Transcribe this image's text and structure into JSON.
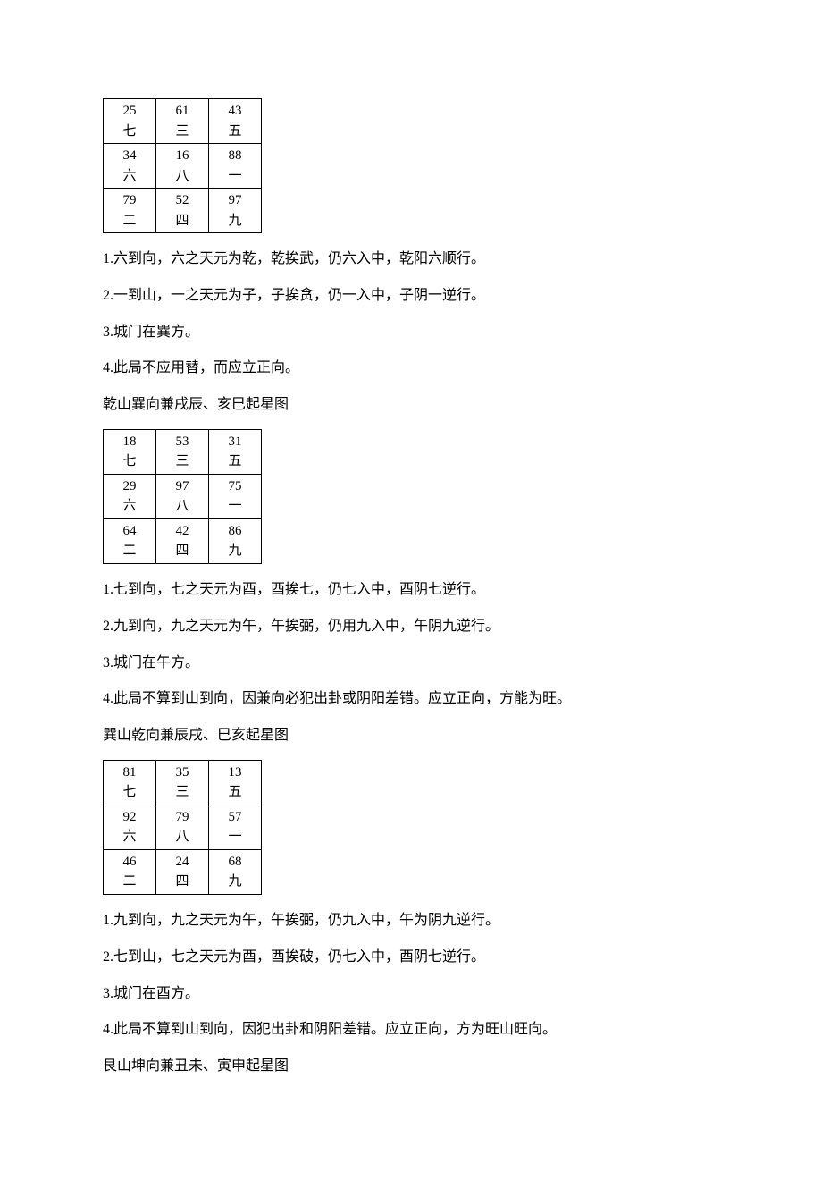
{
  "tables": [
    {
      "rows": [
        [
          {
            "top": "25",
            "bottom": "七"
          },
          {
            "top": "61",
            "bottom": "三"
          },
          {
            "top": "43",
            "bottom": "五"
          }
        ],
        [
          {
            "top": "34",
            "bottom": "六"
          },
          {
            "top": "16",
            "bottom": "八"
          },
          {
            "top": "88",
            "bottom": "一"
          }
        ],
        [
          {
            "top": "79",
            "bottom": "二"
          },
          {
            "top": "52",
            "bottom": "四"
          },
          {
            "top": "97",
            "bottom": "九"
          }
        ]
      ]
    },
    {
      "rows": [
        [
          {
            "top": "18",
            "bottom": "七"
          },
          {
            "top": "53",
            "bottom": "三"
          },
          {
            "top": "31",
            "bottom": "五"
          }
        ],
        [
          {
            "top": "29",
            "bottom": "六"
          },
          {
            "top": "97",
            "bottom": "八"
          },
          {
            "top": "75",
            "bottom": "一"
          }
        ],
        [
          {
            "top": "64",
            "bottom": "二"
          },
          {
            "top": "42",
            "bottom": "四"
          },
          {
            "top": "86",
            "bottom": "九"
          }
        ]
      ]
    },
    {
      "rows": [
        [
          {
            "top": "81",
            "bottom": "七"
          },
          {
            "top": "35",
            "bottom": "三"
          },
          {
            "top": "13",
            "bottom": "五"
          }
        ],
        [
          {
            "top": "92",
            "bottom": "六"
          },
          {
            "top": "79",
            "bottom": "八"
          },
          {
            "top": "57",
            "bottom": "一"
          }
        ],
        [
          {
            "top": "46",
            "bottom": "二"
          },
          {
            "top": "24",
            "bottom": "四"
          },
          {
            "top": "68",
            "bottom": "九"
          }
        ]
      ]
    }
  ],
  "sections": [
    {
      "notes": [
        "1.六到向，六之天元为乾，乾挨武，仍六入中，乾阳六顺行。",
        "2.一到山，一之天元为子，子挨贪，仍一入中，子阴一逆行。",
        "3.城门在巽方。",
        "4.此局不应用替，而应立正向。"
      ],
      "title": "乾山巽向兼戌辰、亥巳起星图"
    },
    {
      "notes": [
        "1.七到向，七之天元为酉，酉挨七，仍七入中，酉阴七逆行。",
        "2.九到向，九之天元为午，午挨弼，仍用九入中，午阴九逆行。",
        "3.城门在午方。",
        "4.此局不算到山到向，因兼向必犯出卦或阴阳差错。应立正向，方能为旺。"
      ],
      "title": "巽山乾向兼辰戌、巳亥起星图"
    },
    {
      "notes": [
        "1.九到向，九之天元为午，午挨弼，仍九入中，午为阴九逆行。",
        "2.七到山，七之天元为酉，酉挨破，仍七入中，酉阴七逆行。",
        "3.城门在酉方。",
        "4.此局不算到山到向，因犯出卦和阴阳差错。应立正向，方为旺山旺向。"
      ],
      "title": "艮山坤向兼丑未、寅申起星图"
    }
  ]
}
